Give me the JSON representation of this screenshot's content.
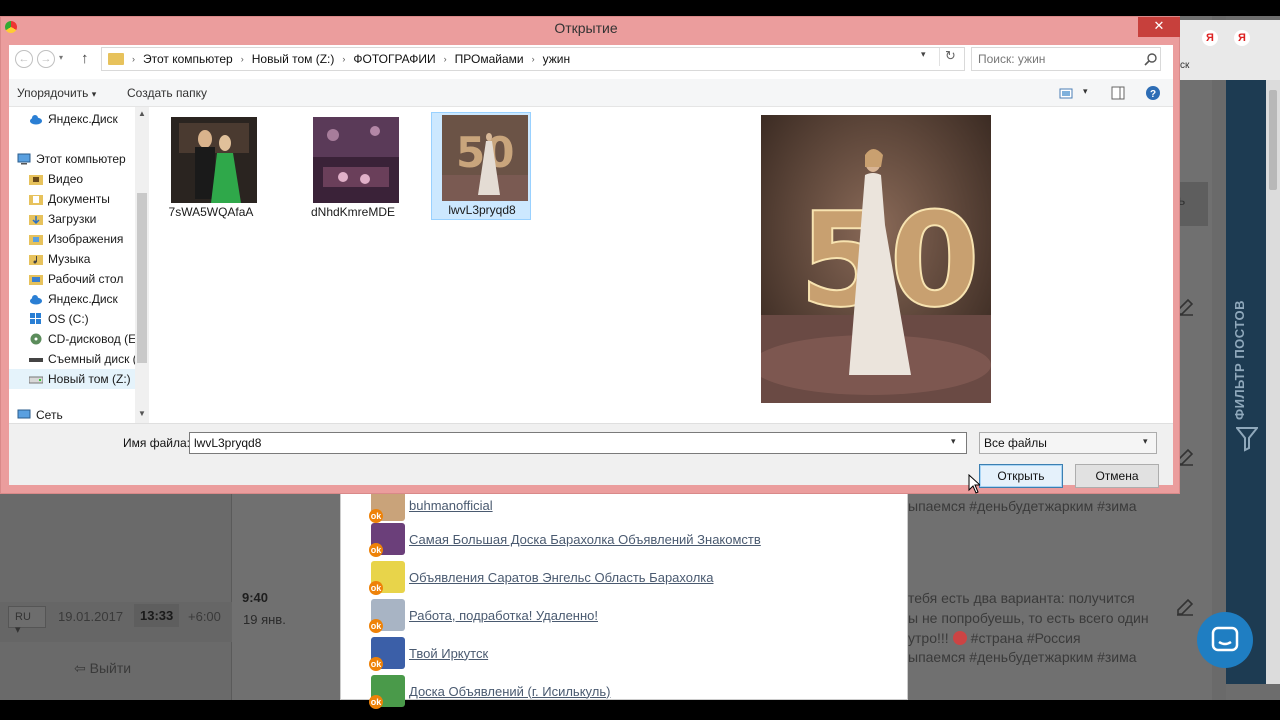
{
  "dialog": {
    "title": "Открытие",
    "close_label": "✕",
    "minimize_label": "—",
    "maximize_label": "☐"
  },
  "address": {
    "crumbs": [
      "Этот компьютер",
      "Новый том (Z:)",
      "ФОТОГРАФИИ",
      "ПРОмайами",
      "ужин"
    ],
    "search_placeholder": "Поиск: ужин"
  },
  "toolbar": {
    "organize_label": "Упорядочить",
    "new_folder_label": "Создать папку"
  },
  "nav": {
    "items": [
      {
        "label": "Яндекс.Диск",
        "icon": "cloud-icon"
      },
      {
        "label": "Этот компьютер",
        "icon": "computer-icon"
      },
      {
        "label": "Видео",
        "icon": "folder-video-icon"
      },
      {
        "label": "Документы",
        "icon": "folder-documents-icon"
      },
      {
        "label": "Загрузки",
        "icon": "folder-downloads-icon"
      },
      {
        "label": "Изображения",
        "icon": "folder-images-icon"
      },
      {
        "label": "Музыка",
        "icon": "folder-music-icon"
      },
      {
        "label": "Рабочий стол",
        "icon": "folder-desktop-icon"
      },
      {
        "label": "Яндекс.Диск",
        "icon": "cloud-icon"
      },
      {
        "label": "OS (C:)",
        "icon": "drive-icon"
      },
      {
        "label": "CD-дисковод (E:",
        "icon": "cd-drive-icon"
      },
      {
        "label": "Съемный диск (",
        "icon": "removable-drive-icon"
      },
      {
        "label": "Новый том (Z:)",
        "icon": "drive-icon"
      },
      {
        "label": "Сеть",
        "icon": "network-icon"
      }
    ]
  },
  "files": [
    {
      "name": "7sWA5WQAfaA",
      "selected": false
    },
    {
      "name": "dNhdKmreMDE",
      "selected": false
    },
    {
      "name": "lwvL3pryqd8",
      "selected": true
    }
  ],
  "preview": {
    "digits": "50"
  },
  "bottom": {
    "filename_label": "Имя файла:",
    "filename_value": "lwvL3pryqd8",
    "filetype_value": "Все файлы",
    "open_label": "Открыть",
    "cancel_label": "Отмена"
  },
  "background": {
    "filter_label": "ФИЛЬТР ПОСТОВ",
    "vk_suffix": "ск",
    "bs_partial": "ь",
    "yandex_letter": "Я",
    "time": "9:40",
    "date": "19 янв.",
    "feed_lines": [
      "ыпаемся #деньбудетжарким #зима",
      "тебя есть два варианта: получится",
      "ы не попробуешь, то есть всего один",
      "утро!!!",
      "#страна #Россия",
      "ыпаемся #деньбудетжарким #зима"
    ],
    "lang": "RU",
    "footer_date": "19.01.2017",
    "footer_time": "13:33",
    "footer_tz": "+6:00",
    "logout_label": "Выйти",
    "groups": [
      "buhmanofficial",
      "Самая Большая Доска Барахолка Объявлений Знакомств",
      "Объявления Саратов Энгельс Область Барахолка",
      "Работа, подработка! Удаленно!",
      "Твой Иркутск",
      "Доска Объявлений (г. Исилькуль)"
    ]
  }
}
